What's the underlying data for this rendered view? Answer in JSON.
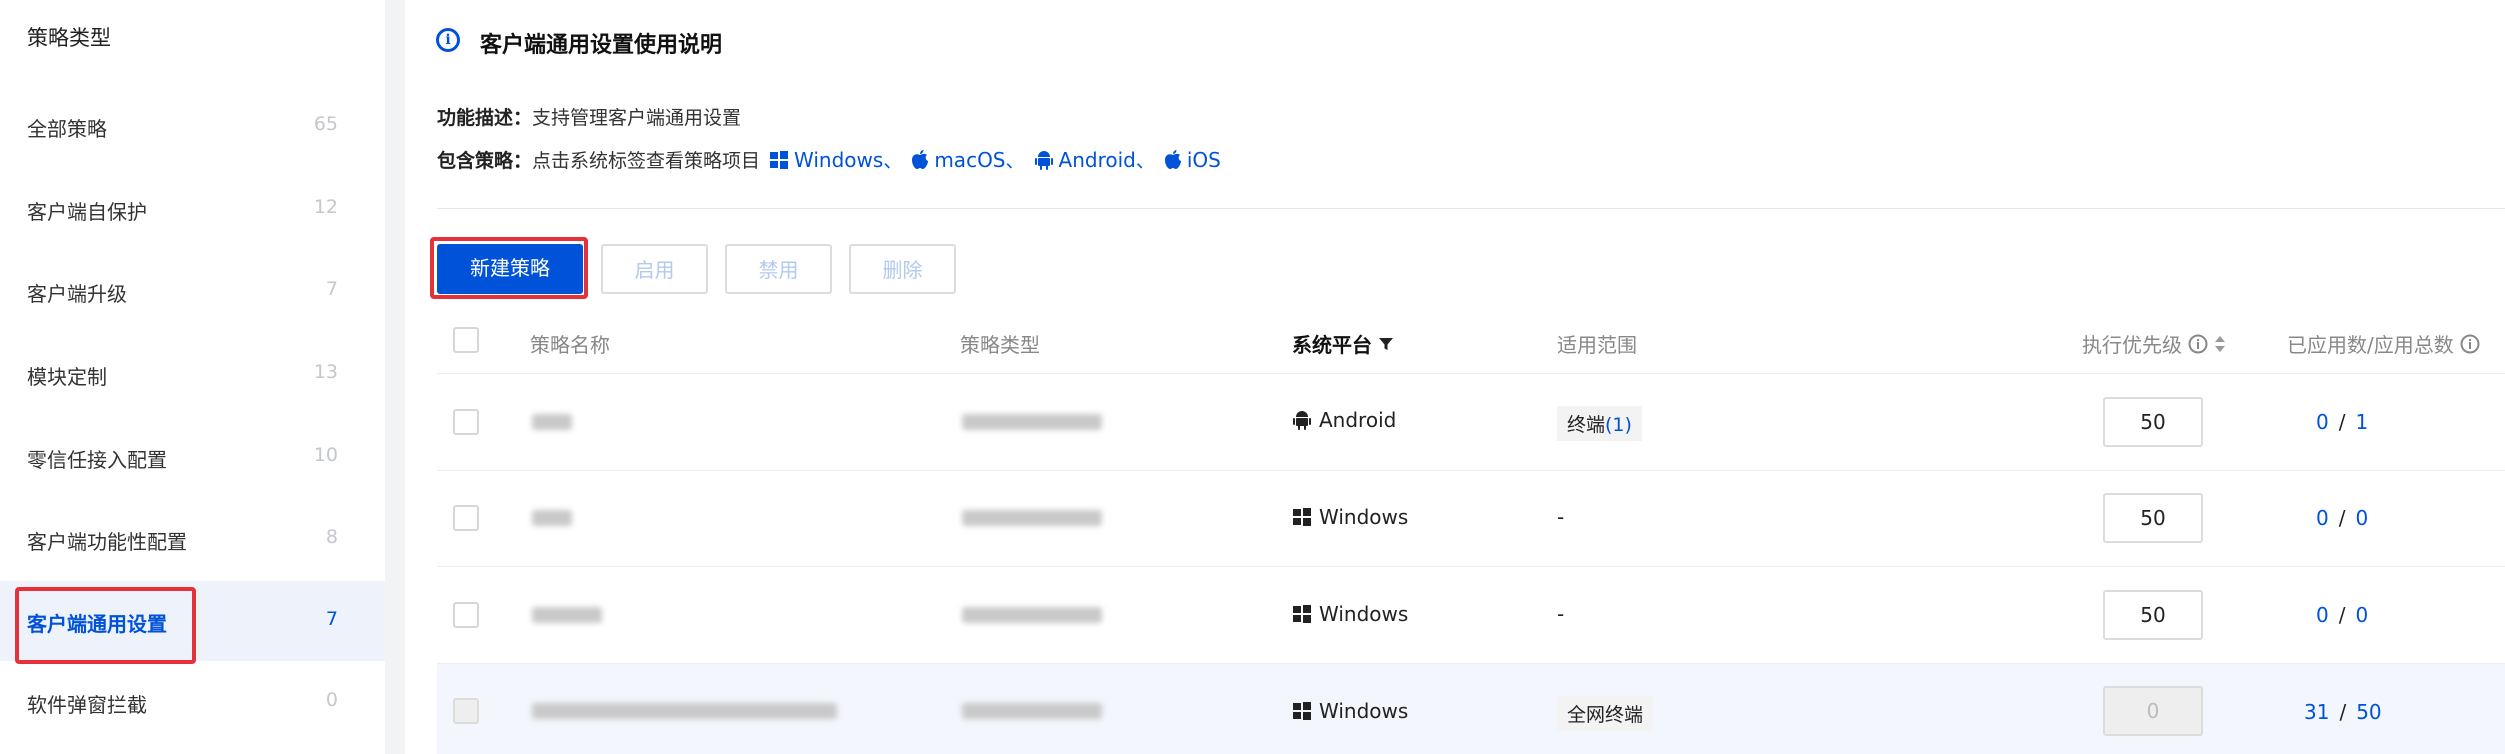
{
  "sidebar": {
    "title": "策略类型",
    "items": [
      {
        "label": "全部策略",
        "count": "65"
      },
      {
        "label": "客户端自保护",
        "count": "12"
      },
      {
        "label": "客户端升级",
        "count": "7"
      },
      {
        "label": "模块定制",
        "count": "13"
      },
      {
        "label": "零信任接入配置",
        "count": "10"
      },
      {
        "label": "客户端功能性配置",
        "count": "8"
      },
      {
        "label": "客户端通用设置",
        "count": "7"
      },
      {
        "label": "软件弹窗拦截",
        "count": "0"
      }
    ]
  },
  "section": {
    "info_glyph": "i",
    "title": "客户端通用设置使用说明",
    "desc_label": "功能描述：",
    "desc_text": "支持管理客户端通用设置",
    "policy_label": "包含策略：",
    "policy_text": "点击系统标签查看策略项目",
    "platforms": [
      "Windows",
      "macOS",
      "Android",
      "iOS"
    ],
    "separator": "、"
  },
  "toolbar": {
    "new_label": "新建策略",
    "enable_label": "启用",
    "disable_label": "禁用",
    "delete_label": "删除"
  },
  "table": {
    "headers": {
      "name": "策略名称",
      "type": "策略类型",
      "platform": "系统平台",
      "scope": "适用范围",
      "priority": "执行优先级",
      "applied": "已应用数/应用总数"
    },
    "rows": [
      {
        "platform": "Android",
        "scope_text": "终端",
        "scope_count": "(1)",
        "priority": "50",
        "applied": "0",
        "total": "1"
      },
      {
        "platform": "Windows",
        "scope_text": "-",
        "scope_count": "",
        "priority": "50",
        "applied": "0",
        "total": "0"
      },
      {
        "platform": "Windows",
        "scope_text": "-",
        "scope_count": "",
        "priority": "50",
        "applied": "0",
        "total": "0"
      },
      {
        "platform": "Windows",
        "scope_text": "全网终端",
        "scope_count": "",
        "priority": "0",
        "applied": "31",
        "total": "50"
      }
    ],
    "slash": "/"
  },
  "colors": {
    "brand": "#0052d9",
    "highlight_outline": "#e5323a",
    "active_row_bg": "#edf2fb"
  },
  "icons": [
    "info-icon",
    "windows-icon",
    "apple-icon",
    "android-icon",
    "filter-icon",
    "sort-icon"
  ]
}
